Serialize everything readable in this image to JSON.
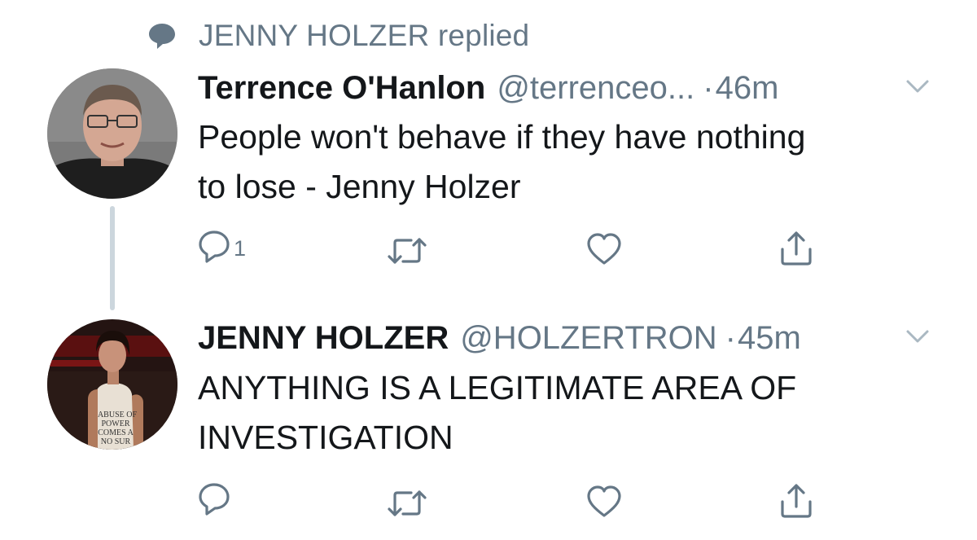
{
  "context": {
    "icon": "speech-bubble-icon",
    "text": "JENNY HOLZER replied"
  },
  "tweets": [
    {
      "name": "Terrence O'Hanlon",
      "handle": "@terrenceo...",
      "dot": "·",
      "time": "46m",
      "lines": [
        "People won't behave if they have nothing",
        "to lose - Jenny Holzer"
      ],
      "reply_count": "1"
    },
    {
      "name": "JENNY HOLZER",
      "handle": "@HOLZERTRON",
      "dot": "·",
      "time": "45m",
      "lines": [
        "ANYTHING IS A LEGITIMATE AREA OF",
        "INVESTIGATION"
      ],
      "reply_count": "",
      "avatar_shirt_text": [
        "ABUSE OF",
        "POWER",
        "COMES A",
        "NO SUR"
      ]
    }
  ],
  "colors": {
    "text": "#14171a",
    "secondary": "#657786",
    "thread_line": "#ccd6dd"
  }
}
